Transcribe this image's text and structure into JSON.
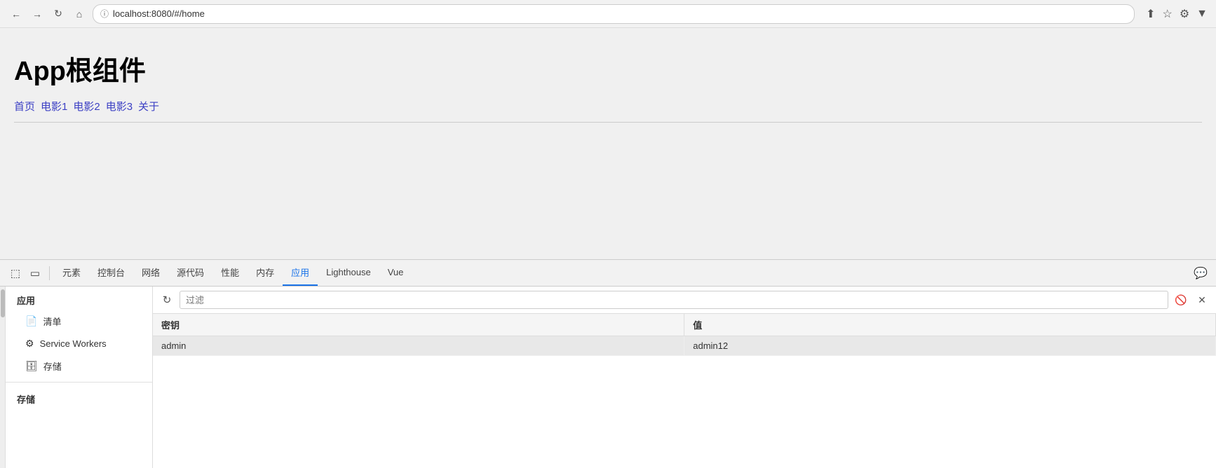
{
  "browser": {
    "url": "localhost:8080/#/home",
    "back_label": "←",
    "forward_label": "→",
    "refresh_label": "↻",
    "home_label": "⌂"
  },
  "page": {
    "title": "App根组件",
    "nav_links": [
      {
        "label": "首页"
      },
      {
        "label": "电影1"
      },
      {
        "label": "电影2"
      },
      {
        "label": "电影3"
      },
      {
        "label": "关于"
      }
    ]
  },
  "devtools": {
    "tabs": [
      {
        "label": "元素",
        "active": false
      },
      {
        "label": "控制台",
        "active": false
      },
      {
        "label": "网络",
        "active": false
      },
      {
        "label": "源代码",
        "active": false
      },
      {
        "label": "性能",
        "active": false
      },
      {
        "label": "内存",
        "active": false
      },
      {
        "label": "应用",
        "active": true
      },
      {
        "label": "Lighthouse",
        "active": false
      },
      {
        "label": "Vue",
        "active": false
      }
    ],
    "sidebar": {
      "sections": [
        {
          "title": "应用",
          "items": [
            {
              "label": "清单",
              "icon": "📄",
              "active": false
            },
            {
              "label": "Service Workers",
              "icon": "⚙️",
              "active": false
            },
            {
              "label": "存储",
              "icon": "🗄️",
              "active": false
            }
          ]
        },
        {
          "title": "存储"
        }
      ]
    },
    "filter": {
      "placeholder": "过滤",
      "value": ""
    },
    "table": {
      "columns": [
        {
          "label": "密钥"
        },
        {
          "label": "值"
        }
      ],
      "rows": [
        {
          "key": "admin",
          "value": "admin12",
          "selected": true
        }
      ]
    }
  }
}
